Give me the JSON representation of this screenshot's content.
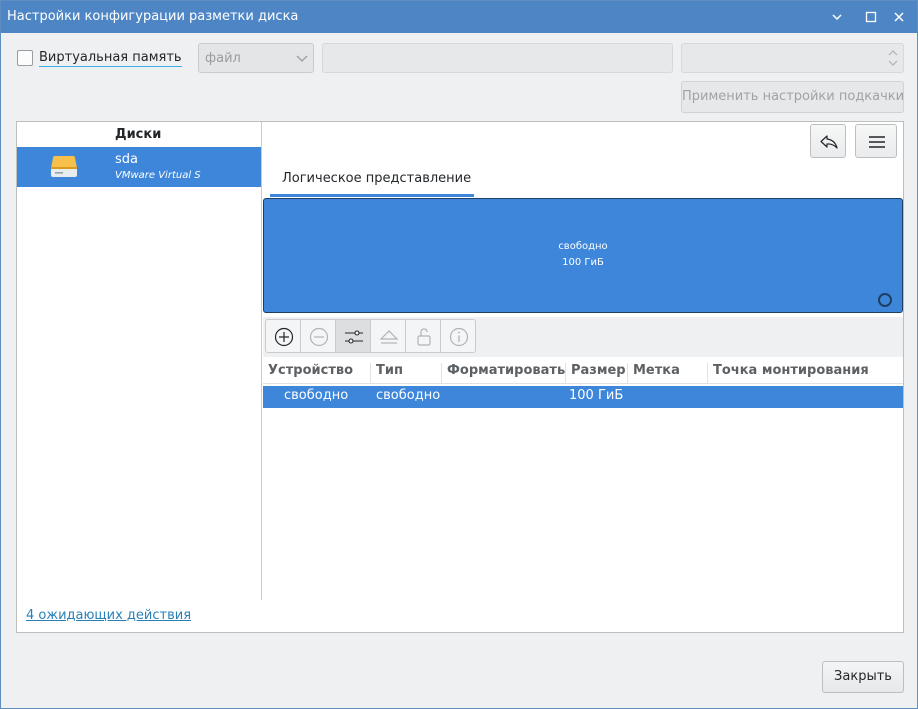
{
  "window": {
    "title": "Настройки конфигурации разметки диска"
  },
  "top": {
    "virtual_memory_label": "Виртуальная память",
    "virtual_memory_checked": false,
    "type_combo_value": "файл",
    "apply_button": "Применить настройки подкачки"
  },
  "disks": {
    "header": "Диски",
    "items": [
      {
        "name": "sda",
        "model": "VMware Virtual S"
      }
    ]
  },
  "pending_link": "4 ожидающих действия",
  "tabs": [
    {
      "label": "Логическое представление",
      "active": true
    }
  ],
  "partition_bar": {
    "label": "свободно",
    "size": "100 ГиБ"
  },
  "table": {
    "columns": [
      "Устройство",
      "Тип",
      "Форматировать",
      "Размер",
      "Метка",
      "Точка монтирования"
    ],
    "rows": [
      [
        "свободно",
        "свободно",
        "",
        "100 ГиБ",
        "",
        ""
      ]
    ]
  },
  "close_button": "Закрыть",
  "colors": {
    "titlebar": "#4e86c5",
    "selection": "#3d86da",
    "link": "#2980b9"
  }
}
